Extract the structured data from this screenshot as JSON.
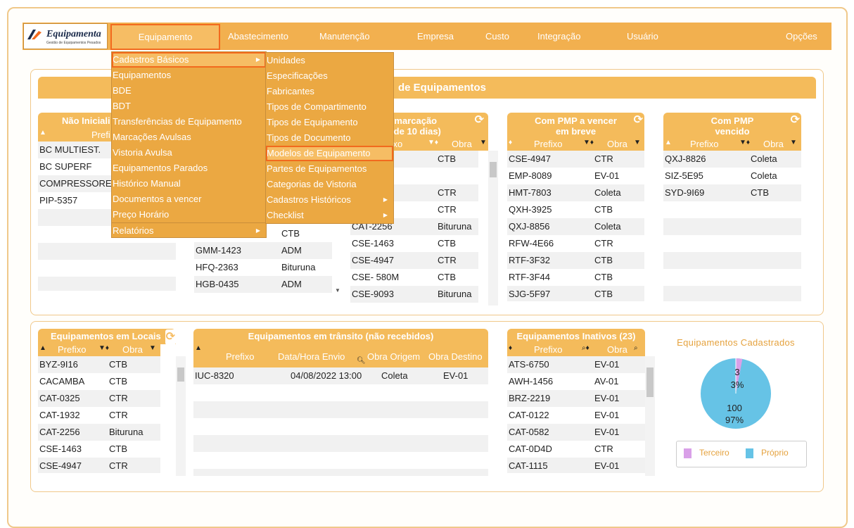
{
  "logo": {
    "brand": "Equipamenta",
    "tagline": "Gestão de Equipamentos Pesados"
  },
  "nav": {
    "items": [
      "Equipamento",
      "Abastecimento",
      "Manutenção",
      "Empresa",
      "Custo",
      "Integração",
      "Usuário",
      "Opções"
    ]
  },
  "menu1": {
    "items": [
      "Cadastros Básicos",
      "Equipamentos",
      "BDE",
      "BDT",
      "Transferências de Equipamento",
      "Marcações Avulsas",
      "Vistoria Avulsa",
      "Equipamentos Parados",
      "Histórico Manual",
      "Documentos a vencer",
      "Preço Horário",
      "Relatórios"
    ]
  },
  "menu2": {
    "items": [
      "Unidades",
      "Especificações",
      "Fabricantes",
      "Tipos de Compartimento",
      "Tipos de Equipamento",
      "Tipos de Documento",
      "Modelos de Equipamento",
      "Partes de Equipamentos",
      "Categorias de Vistoria",
      "Cadastros Históricos",
      "Checklist"
    ]
  },
  "top_panel": {
    "title": "de Equipamentos"
  },
  "w1": {
    "title": "Não Iniciali",
    "col1": "Prefi",
    "rows": [
      "BC MULTIEST.",
      "BC SUPERF",
      "COMPRESSORE",
      "PIP-5357",
      "",
      "",
      "",
      ""
    ]
  },
  "w2": {
    "rows": [
      [
        "",
        "CTB"
      ],
      [
        "GMM-1423",
        "ADM"
      ],
      [
        "HFQ-2363",
        "Bituruna"
      ],
      [
        "HGB-0435",
        "ADM"
      ]
    ]
  },
  "w3": {
    "title1": "em marcação",
    "title2": "ais de 10 dias)",
    "col1": "fixo",
    "col2": "Obra",
    "rows": [
      [
        "",
        "CTB"
      ],
      [
        "A",
        ""
      ],
      [
        "",
        "CTR"
      ],
      [
        "",
        "CTR"
      ],
      [
        "CAT-2256",
        "Bituruna"
      ],
      [
        "CSE-1463",
        "CTB"
      ],
      [
        "CSE-4947",
        "CTR"
      ],
      [
        "CSE- 580M",
        "CTB"
      ],
      [
        "CSE-9093",
        "Bituruna"
      ]
    ]
  },
  "w4": {
    "title1": "Com PMP a vencer",
    "title2": "em breve",
    "col1": "Prefixo",
    "col2": "Obra",
    "rows": [
      [
        "CSE-4947",
        "CTR"
      ],
      [
        "EMP-8089",
        "EV-01"
      ],
      [
        "HMT-7803",
        "Coleta"
      ],
      [
        "QXH-3925",
        "CTB"
      ],
      [
        "QXJ-8856",
        "Coleta"
      ],
      [
        "RFW-4E66",
        "CTR"
      ],
      [
        "RTF-3F32",
        "CTB"
      ],
      [
        "RTF-3F44",
        "CTB"
      ],
      [
        "SJG-5F97",
        "CTB"
      ]
    ]
  },
  "w5": {
    "title1": "Com PMP",
    "title2": "vencido",
    "col1": "Prefixo",
    "col2": "Obra",
    "rows": [
      [
        "QXJ-8826",
        "Coleta"
      ],
      [
        "SIZ-5E95",
        "Coleta"
      ],
      [
        "SYD-9I69",
        "CTB"
      ],
      [
        "",
        ""
      ],
      [
        "",
        ""
      ],
      [
        "",
        ""
      ],
      [
        "",
        ""
      ],
      [
        "",
        ""
      ],
      [
        "",
        ""
      ]
    ]
  },
  "w6": {
    "title": "Equipamentos em Locais",
    "col1": "Prefixo",
    "col2": "Obra",
    "rows": [
      [
        "BYZ-9I16",
        "CTB"
      ],
      [
        "CACAMBA",
        "CTB"
      ],
      [
        "CAT-0325",
        "CTR"
      ],
      [
        "CAT-1932",
        "CTR"
      ],
      [
        "CAT-2256",
        "Bituruna"
      ],
      [
        "CSE-1463",
        "CTB"
      ],
      [
        "CSE-4947",
        "CTR"
      ]
    ]
  },
  "w7": {
    "title": "Equipamentos em trânsito (não recebidos)",
    "col1": "Prefixo",
    "col2": "Data/Hora Envio",
    "col3": "Obra Origem",
    "col4": "Obra Destino",
    "rows": [
      [
        "IUC-8320",
        "04/08/2022 13:00",
        "Coleta",
        "EV-01"
      ],
      [
        "",
        "",
        "",
        ""
      ],
      [
        "",
        "",
        "",
        ""
      ],
      [
        "",
        "",
        "",
        ""
      ],
      [
        "",
        "",
        "",
        ""
      ],
      [
        "",
        "",
        "",
        ""
      ],
      [
        "",
        "",
        "",
        ""
      ]
    ]
  },
  "w8": {
    "title": "Equipamentos Inativos (23)",
    "col1": "Prefixo",
    "col2": "Obra",
    "rows": [
      [
        "ATS-6750",
        "EV-01"
      ],
      [
        "AWH-1456",
        "AV-01"
      ],
      [
        "BRZ-2219",
        "EV-01"
      ],
      [
        "CAT-0122",
        "EV-01"
      ],
      [
        "CAT-0582",
        "EV-01"
      ],
      [
        "CAT-0D4D",
        "CTR"
      ],
      [
        "CAT-1115",
        "EV-01"
      ]
    ]
  },
  "pie": {
    "title": "Equipamentos Cadastrados",
    "terceiro_count": "3",
    "terceiro_pct": "3%",
    "proprio_count": "100",
    "proprio_pct": "97%",
    "legend_terceiro": "Terceiro",
    "legend_proprio": "Próprio",
    "color_terceiro": "#d9a0e8",
    "color_proprio": "#66c3e6"
  },
  "colors": {
    "accent": "#f4bb5b",
    "highlight": "#f26a1e"
  }
}
